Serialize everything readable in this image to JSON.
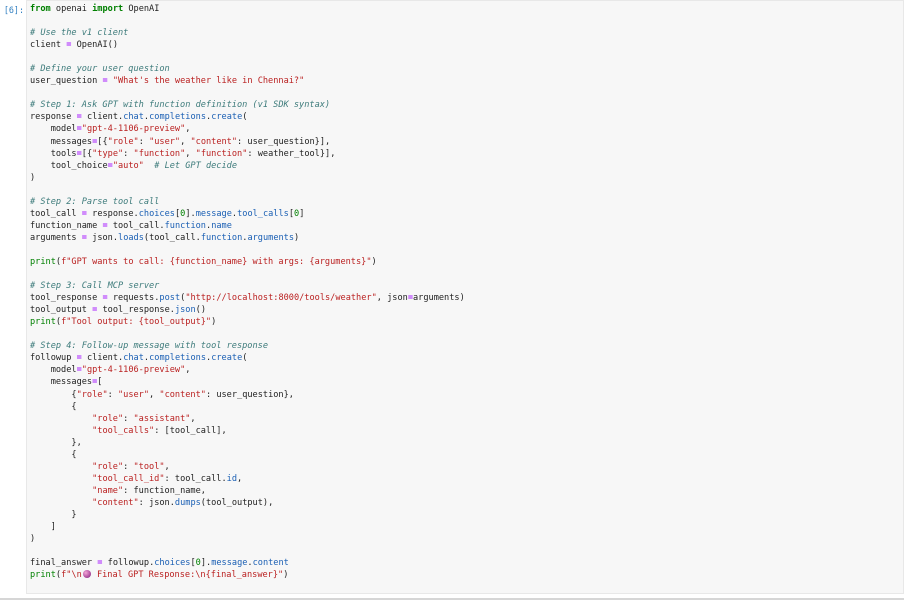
{
  "cell": {
    "prompt": "[6]:"
  },
  "code": {
    "lines": [
      "from openai import OpenAI",
      "",
      "# Use the v1 client",
      "client = OpenAI()",
      "",
      "# Define your user question",
      "user_question = \"What's the weather like in Chennai?\"",
      "",
      "# Step 1: Ask GPT with function definition (v1 SDK syntax)",
      "response = client.chat.completions.create(",
      "    model=\"gpt-4-1106-preview\",",
      "    messages=[{\"role\": \"user\", \"content\": user_question}],",
      "    tools=[{\"type\": \"function\", \"function\": weather_tool}],",
      "    tool_choice=\"auto\"  # Let GPT decide",
      ")",
      "",
      "# Step 2: Parse tool call",
      "tool_call = response.choices[0].message.tool_calls[0]",
      "function_name = tool_call.function.name",
      "arguments = json.loads(tool_call.function.arguments)",
      "",
      "print(f\"GPT wants to call: {function_name} with args: {arguments}\")",
      "",
      "# Step 3: Call MCP server",
      "tool_response = requests.post(\"http://localhost:8000/tools/weather\", json=arguments)",
      "tool_output = tool_response.json()",
      "print(f\"Tool output: {tool_output}\")",
      "",
      "# Step 4: Follow-up message with tool response",
      "followup = client.chat.completions.create(",
      "    model=\"gpt-4-1106-preview\",",
      "    messages=[",
      "        {\"role\": \"user\", \"content\": user_question},",
      "        {",
      "            \"role\": \"assistant\",",
      "            \"tool_calls\": [tool_call],",
      "        },",
      "        {",
      "            \"role\": \"tool\",",
      "            \"tool_call_id\": tool_call.id,",
      "            \"name\": function_name,",
      "            \"content\": json.dumps(tool_output),",
      "        }",
      "    ]",
      ")",
      "",
      "final_answer = followup.choices[0].message.content",
      "print(f\"\\n🔮 Final GPT Response:\\n{final_answer}\")"
    ]
  },
  "icons": {
    "emoji": "crystal-ball-icon"
  }
}
